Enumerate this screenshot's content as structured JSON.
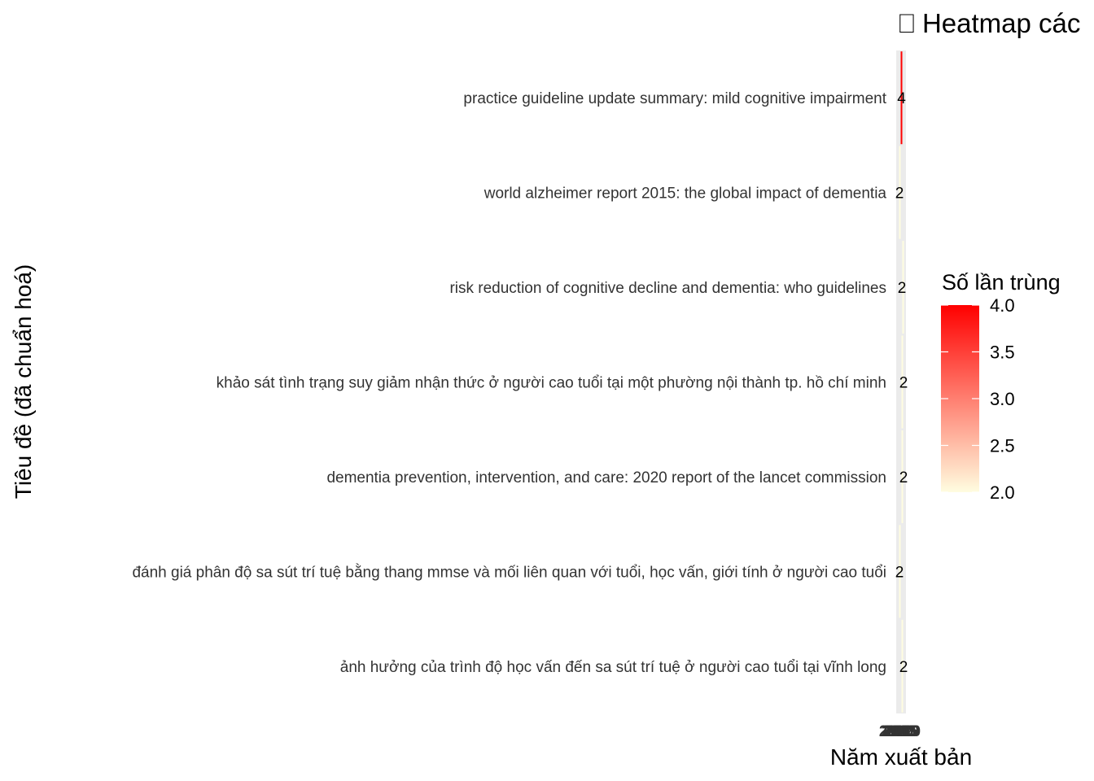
{
  "chart_data": {
    "type": "heatmap",
    "title": "⎕ Heatmap các",
    "xlabel": "Năm xuất bản",
    "ylabel": "Tiêu đề (đã chuẩn hoá)",
    "x_tick_labels": [
      "2020",
      "2018",
      "2015",
      "2019",
      "2010"
    ],
    "rows": [
      {
        "title": "practice guideline update summary: mild cognitive impairment",
        "value": 4,
        "label": "4"
      },
      {
        "title": "world alzheimer report 2015: the global impact of dementia",
        "value": 2,
        "label": "2"
      },
      {
        "title": "risk reduction of cognitive decline and dementia: who guidelines",
        "value": 2,
        "label": "2"
      },
      {
        "title": "khảo sát tình trạng suy giảm nhận thức ở người cao tuổi tại một phường nội thành tp. hồ chí minh",
        "value": 2,
        "label": "2"
      },
      {
        "title": "dementia prevention, intervention, and care: 2020 report of the lancet commission",
        "value": 2,
        "label": "2"
      },
      {
        "title": "đánh giá phân độ sa sút trí tuệ bằng thang mmse và mối liên quan với tuổi, học vấn, giới tính ở người cao tuổi",
        "value": 2,
        "label": "2"
      },
      {
        "title": "ảnh hưởng của trình độ học vấn đến sa sút trí tuệ ở người cao tuổi tại vĩnh long",
        "value": 2,
        "label": "2"
      }
    ],
    "legend": {
      "title": "Số lần trùng",
      "ticks": [
        "4.0",
        "3.5",
        "3.0",
        "2.5",
        "2.0"
      ],
      "range": [
        2,
        4
      ],
      "low_color": "#fffde0",
      "high_color": "#ff0000"
    },
    "panel_background": "#ebebeb"
  }
}
